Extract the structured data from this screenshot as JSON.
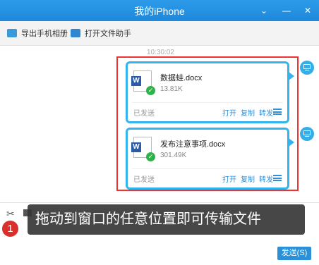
{
  "window": {
    "title": "我的iPhone",
    "minimize_glyph": "⌄",
    "restore_glyph": "—",
    "close_glyph": "✕"
  },
  "toolbar": {
    "export_album": "导出手机相册",
    "open_file_helper": "打开文件助手"
  },
  "chat": {
    "timestamp": "10:30:02",
    "messages": [
      {
        "file_name": "数据蛙.docx",
        "file_size": "13.81K",
        "status": "已发送",
        "actions": [
          "打开",
          "复制",
          "转发"
        ],
        "icon": "word-doc-icon"
      },
      {
        "file_name": "发布注意事项.docx",
        "file_size": "301.49K",
        "status": "已发送",
        "actions": [
          "打开",
          "复制",
          "转发"
        ],
        "icon": "word-doc-icon"
      }
    ]
  },
  "tooltip": {
    "step_number": "1",
    "text": "拖动到窗口的任意位置即可传输文件"
  },
  "input": {
    "send_label": "发送(S)"
  },
  "colors": {
    "accent": "#2d9be9",
    "highlight_border": "#e33333",
    "card_border": "#34b4ee",
    "badge": "#d9302c"
  }
}
